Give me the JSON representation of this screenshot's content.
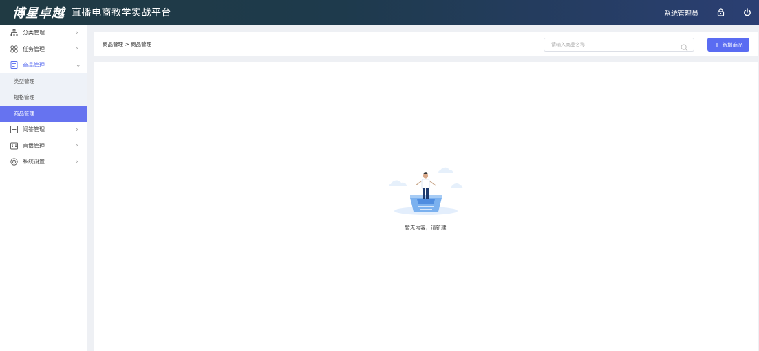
{
  "header": {
    "logo_text": "博星卓越",
    "title": "直播电商教学实战平台",
    "user_label": "系统管理员",
    "lock_icon": "lock-icon",
    "power_icon": "power-icon"
  },
  "sidebar": {
    "items": [
      {
        "label": "分类管理",
        "icon": "category-tree-icon",
        "arrow": "›"
      },
      {
        "label": "任务管理",
        "icon": "grid-icon",
        "arrow": "›"
      },
      {
        "label": "商品管理",
        "icon": "document-icon",
        "arrow": "⌄",
        "expanded": true,
        "children": [
          {
            "label": "类型管理"
          },
          {
            "label": "规格管理"
          },
          {
            "label": "商品管理",
            "active": true
          }
        ]
      },
      {
        "label": "问答管理",
        "icon": "qa-icon",
        "arrow": "›"
      },
      {
        "label": "直播管理",
        "icon": "broadcast-icon",
        "arrow": "›"
      },
      {
        "label": "系统设置",
        "icon": "settings-icon",
        "arrow": "›"
      }
    ]
  },
  "toolbar": {
    "breadcrumb": "商品管理 > 商品管理",
    "search_placeholder": "请输入商品名称",
    "search_value": "",
    "add_button_label": "新增商品"
  },
  "main": {
    "empty_text": "暂无内容，请新建"
  },
  "colors": {
    "accent": "#5a6cf2",
    "header_start": "#203a43",
    "header_end": "#2b3f73",
    "active_bg": "#6673f0"
  }
}
